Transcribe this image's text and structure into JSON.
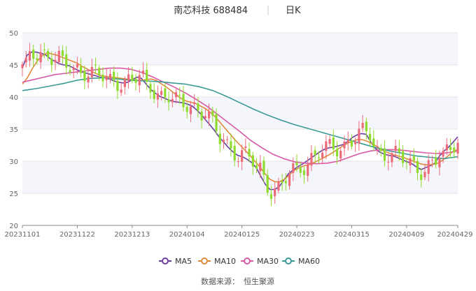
{
  "header": {
    "stock_title": "南芯科技 688484",
    "period_label": "日K"
  },
  "legend": {
    "items": [
      {
        "label": "MA5",
        "color": "#6a3fa5"
      },
      {
        "label": "MA10",
        "color": "#e08a3c"
      },
      {
        "label": "MA30",
        "color": "#d85aa6"
      },
      {
        "label": "MA60",
        "color": "#3a9a96"
      }
    ]
  },
  "source": {
    "label": "数据来源：",
    "name": "恒生聚源"
  },
  "colors": {
    "up": "#f0a0a8",
    "up_strong": "#ec6b7b",
    "down": "#b4e46a",
    "down_strong": "#8fdc2e",
    "grid": "#e5e5e5",
    "band": "#f5f6fc"
  },
  "chart_data": {
    "type": "candlestick",
    "title": "南芯科技 688484 日K",
    "ylim": [
      20,
      50
    ],
    "yticks": [
      20,
      25,
      30,
      35,
      40,
      45,
      50
    ],
    "xtick_labels": [
      "20231101",
      "20231122",
      "20231213",
      "20240104",
      "20240125",
      "20240223",
      "20240315",
      "20240409",
      "20240429"
    ],
    "xtick_positions": [
      0,
      15,
      30,
      45,
      60,
      75,
      90,
      105,
      119
    ],
    "series": [
      {
        "name": "MA5",
        "values": [
          44.5,
          46.5,
          47.0,
          47.0,
          46.8,
          46.6,
          46.0,
          45.6,
          45.2,
          45.0,
          44.9,
          44.6,
          44.2,
          43.9,
          43.7,
          43.5,
          43.3,
          43.1,
          43.0,
          42.8,
          42.5,
          42.3,
          42.2,
          42.3,
          42.7,
          43.1,
          42.9,
          42.0,
          41.2,
          40.6,
          40.1,
          39.8,
          39.5,
          39.3,
          39.2,
          39.1,
          38.9,
          38.6,
          38.0,
          37.3,
          36.4,
          35.6,
          34.7,
          33.7,
          32.9,
          32.1,
          31.4,
          30.9,
          30.7,
          30.3,
          29.8,
          29.0,
          27.7,
          26.4,
          25.6,
          25.6,
          26.0,
          27.0,
          28.0,
          28.6,
          29.1,
          29.5,
          30.0,
          30.5,
          31.0,
          31.5,
          31.9,
          32.1,
          32.2,
          32.4,
          32.6,
          33.1,
          33.7,
          34.1,
          34.3,
          34.2,
          33.0,
          32.0,
          31.4,
          31.1,
          30.9,
          30.8,
          30.5,
          30.2,
          29.9,
          29.6,
          29.1,
          28.7,
          29.0,
          29.3,
          29.7,
          30.8,
          31.6,
          32.2,
          33.0,
          33.8
        ],
        "x_start": 0
      },
      {
        "name": "MA10",
        "values": [
          42.0,
          43.0,
          44.4,
          45.6,
          46.4,
          46.9,
          46.7,
          46.5,
          46.2,
          45.9,
          45.6,
          45.3,
          44.8,
          44.4,
          44.0,
          43.6,
          43.3,
          43.2,
          43.1,
          43.0,
          42.9,
          42.8,
          42.7,
          42.6,
          42.6,
          42.7,
          42.8,
          42.6,
          42.1,
          41.6,
          41.0,
          40.4,
          39.8,
          39.4,
          39.2,
          39.0,
          38.6,
          38.2,
          37.6,
          36.9,
          36.0,
          35.1,
          34.2,
          33.3,
          32.5,
          31.7,
          30.9,
          30.0,
          29.1,
          28.1,
          27.2,
          26.8,
          26.8,
          27.2,
          27.9,
          28.6,
          29.0,
          29.3,
          29.5,
          29.8,
          30.2,
          30.6,
          31.0,
          31.5,
          32.0,
          32.5,
          32.9,
          33.2,
          33.4,
          33.3,
          33.0,
          32.6,
          32.1,
          31.6,
          31.3,
          31.0,
          30.8,
          30.6,
          30.3,
          30.0,
          29.7,
          29.5,
          29.4,
          29.5,
          29.7,
          30.2,
          30.8,
          31.5,
          31.8
        ],
        "x_start": 0
      },
      {
        "name": "MA30",
        "values": [
          42.3,
          42.7,
          43.1,
          43.5,
          43.7,
          43.9,
          44.1,
          44.3,
          44.5,
          44.5,
          44.3,
          43.8,
          43.1,
          42.3,
          41.5,
          40.6,
          39.6,
          38.5,
          37.2,
          35.9,
          34.6,
          33.2,
          32.1,
          31.1,
          30.4,
          29.9,
          29.7,
          29.6,
          29.7,
          30.0,
          30.6,
          31.2,
          31.6,
          31.8,
          31.8,
          31.7,
          31.5,
          31.3,
          31.2,
          31.3,
          31.6
        ],
        "x_start": 0
      },
      {
        "name": "MA60",
        "values": [
          41.0,
          41.3,
          41.7,
          42.1,
          42.6,
          42.9,
          43.0,
          42.8,
          42.6,
          42.5,
          42.4,
          42.2,
          42.0,
          41.6,
          41.0,
          40.1,
          39.1,
          38.1,
          37.2,
          36.4,
          35.7,
          35.1,
          34.5,
          33.9,
          33.3,
          32.7,
          32.1,
          31.6,
          31.2,
          30.8,
          30.6,
          30.4,
          30.7
        ],
        "x_start": 0
      }
    ]
  }
}
